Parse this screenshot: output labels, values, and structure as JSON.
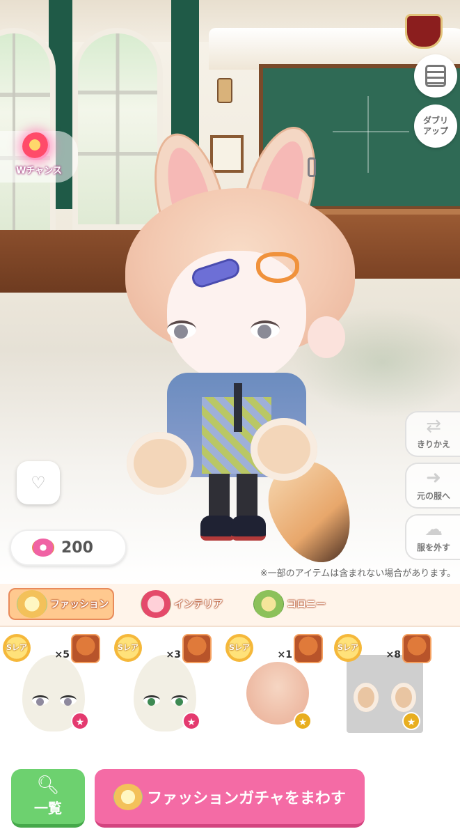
{
  "overlay": {
    "wchance_label": "Wチャンス",
    "menu_icon": "hamburger-menu-icon",
    "duplicate_label_line1": "ダブリ",
    "duplicate_label_line2": "アップ",
    "swap_label": "きりかえ",
    "revert_label": "元の服へ",
    "remove_label": "服を外す",
    "donut_count": "200",
    "disclaimer": "※一部のアイテムは含まれない場合があります。"
  },
  "tabs": [
    {
      "label": "ファッション",
      "selected": true
    },
    {
      "label": "インテリア",
      "selected": false
    },
    {
      "label": "コロニー",
      "selected": false
    }
  ],
  "items": [
    {
      "rarity": "Sレア",
      "quantity": "×5",
      "type": "eyes-gray",
      "badge": "pink-star"
    },
    {
      "rarity": "Sレア",
      "quantity": "×3",
      "type": "eyes-green",
      "badge": "pink-star"
    },
    {
      "rarity": "Sレア",
      "quantity": "×1",
      "type": "hair",
      "badge": "gold-star"
    },
    {
      "rarity": "Sレア",
      "quantity": "×8",
      "type": "paw-gloves",
      "badge": "gold-star",
      "selected": true
    }
  ],
  "buttons": {
    "list_label": "一覧",
    "gacha_label": "ファッションガチャをまわす"
  },
  "colors": {
    "tab_bg": "#fff4ea",
    "list_button": "#6dd16f",
    "gacha_button": "#f46ba5"
  }
}
